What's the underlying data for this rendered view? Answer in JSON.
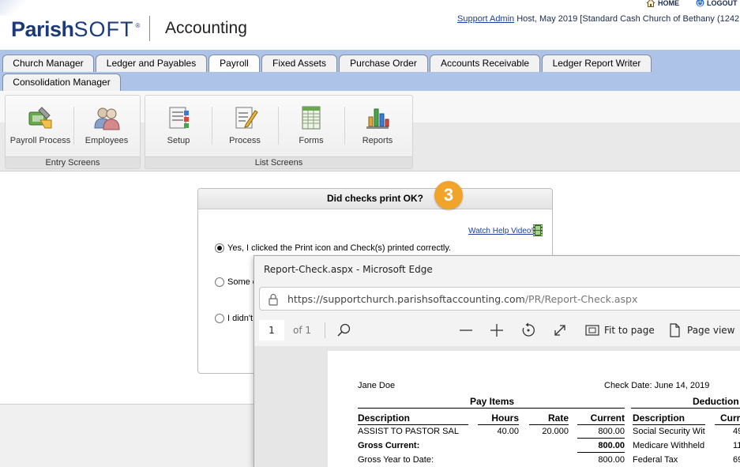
{
  "header": {
    "logo_text_bold": "Parish",
    "logo_text_light": "SOFT",
    "logo_reg": "®",
    "app_title": "Accounting",
    "home_label": "HOME",
    "logout_label": "LOGOUT",
    "user_name": "Support Admin",
    "user_context": " Host, May 2019 [Standard Cash Church of Bethany (1242"
  },
  "tabs": [
    {
      "label": "Church Manager"
    },
    {
      "label": "Ledger and Payables"
    },
    {
      "label": "Payroll",
      "active": true
    },
    {
      "label": "Fixed Assets"
    },
    {
      "label": "Purchase Order"
    },
    {
      "label": "Accounts Receivable"
    },
    {
      "label": "Ledger Report Writer"
    },
    {
      "label": "Consolidation Manager"
    }
  ],
  "ribbon": {
    "entry_group_label": "Entry Screens",
    "list_group_label": "List Screens",
    "entry_buttons": [
      {
        "label": "Payroll Process",
        "icon": "payroll-process-icon"
      },
      {
        "label": "Employees",
        "icon": "employees-icon"
      }
    ],
    "list_buttons": [
      {
        "label": "Setup",
        "icon": "setup-icon"
      },
      {
        "label": "Process",
        "icon": "process-icon"
      },
      {
        "label": "Forms",
        "icon": "forms-icon"
      },
      {
        "label": "Reports",
        "icon": "reports-icon"
      }
    ]
  },
  "dialog": {
    "title": "Did checks print OK?",
    "help_link": "Watch Help Video!",
    "options": [
      {
        "label": "Yes, I clicked the Print icon and Check(s) printed correctly.",
        "checked": true
      },
      {
        "label": "Some c",
        "checked": false
      },
      {
        "label": "I didn't",
        "checked": false
      }
    ]
  },
  "step_badge": "3",
  "edge": {
    "window_title": "Report-Check.aspx - Microsoft Edge",
    "url_host": "https://supportchurch.parishsoftaccounting.com",
    "url_path": "/PR/Report-Check.aspx",
    "page_number": "1",
    "page_of": "of 1",
    "fit_to_page": "Fit to page",
    "page_view": "Page view"
  },
  "check": {
    "employee": "Jane Doe",
    "check_date": "Check Date: June 14, 2019",
    "pay_items_heading": "Pay Items",
    "deductions_heading": "Deduction",
    "pay_columns": [
      "Description",
      "Hours",
      "Rate",
      "Current"
    ],
    "ded_columns": [
      "Description",
      "Curr"
    ],
    "pay_rows": [
      {
        "description": "ASSIST TO PASTOR SAL",
        "hours": "40.00",
        "rate": "20.000",
        "current": "800.00"
      }
    ],
    "gross_current_label": "Gross Current:",
    "gross_current": "800.00",
    "gross_ytd_label": "Gross Year to Date:",
    "gross_ytd": "800.00",
    "deductions": [
      {
        "description": "Social Security Wit",
        "current": "49"
      },
      {
        "description": "Medicare Withheld",
        "current": "11"
      },
      {
        "description": "Federal Tax",
        "current": "69"
      }
    ]
  },
  "colors": {
    "tab_band": "#adc3e8",
    "brand": "#1b3a7a",
    "badge": "#f2a42a"
  }
}
